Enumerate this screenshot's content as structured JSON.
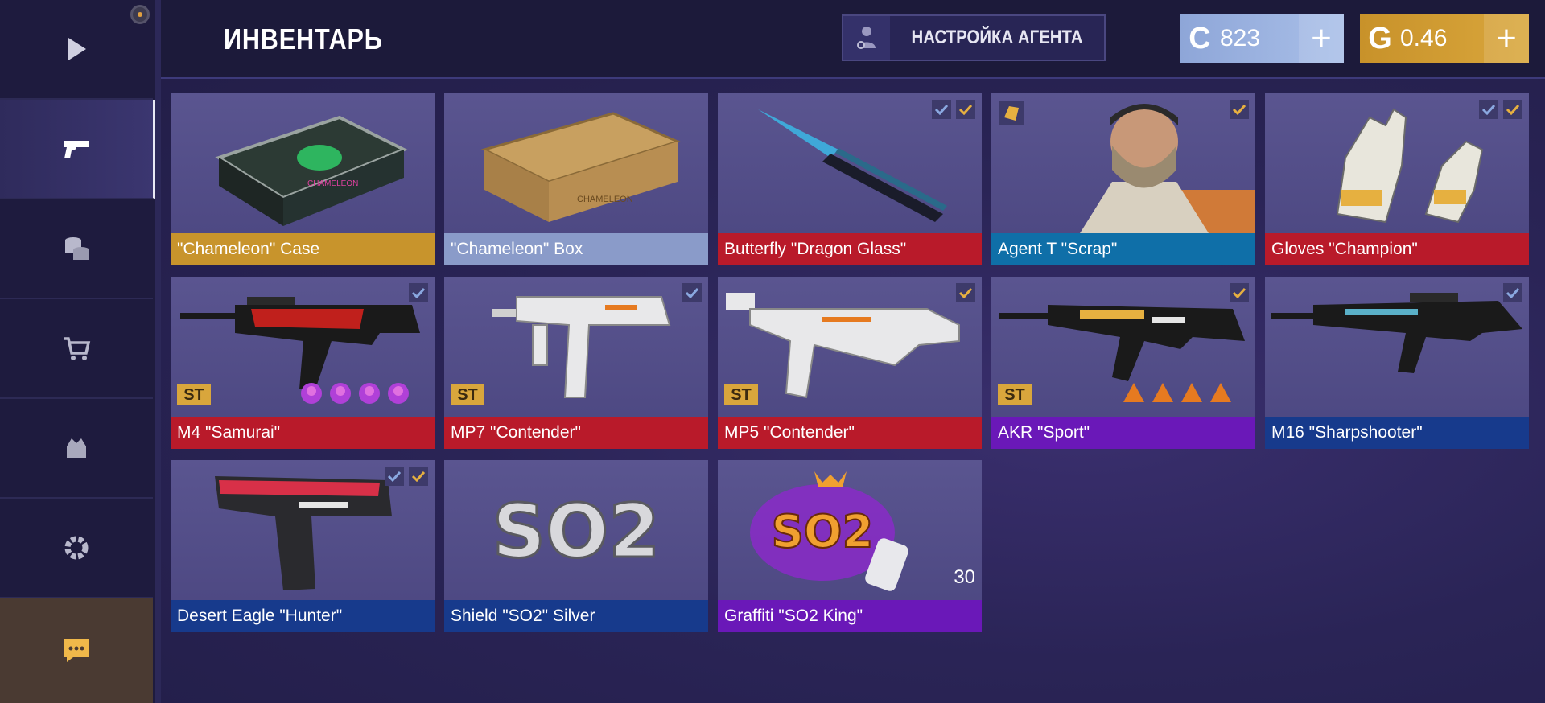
{
  "header": {
    "title": "ИНВЕНТАРЬ",
    "agent_button": "НАСТРОЙКА АГЕНТА",
    "credits": {
      "symbol": "C",
      "amount": "823",
      "plus": "+"
    },
    "gold": {
      "symbol": "G",
      "amount": "0.46",
      "plus": "+"
    }
  },
  "sidebar": {
    "items": [
      {
        "icon": "play-icon"
      },
      {
        "icon": "pistol-icon",
        "active": true
      },
      {
        "icon": "coins-icon"
      },
      {
        "icon": "cart-icon"
      },
      {
        "icon": "clan-icon"
      },
      {
        "icon": "gear-icon"
      },
      {
        "icon": "chat-icon"
      }
    ]
  },
  "colors": {
    "gold": "#d9a63c",
    "silver": "#8ea6d8",
    "red": "#c0192a",
    "blue": "#0f57a8",
    "purple": "#7a18c8",
    "dark_blue": "#173a8c"
  },
  "items": [
    {
      "name": "\"Chameleon\" Case",
      "rarity_color": "#c8942c",
      "checks": []
    },
    {
      "name": "\"Chameleon\" Box",
      "rarity_color": "#8a9bc9",
      "checks": []
    },
    {
      "name": "Butterfly \"Dragon Glass\"",
      "rarity_color": "#b91a2a",
      "checks": [
        "blue",
        "gold"
      ]
    },
    {
      "name": "Agent T \"Scrap\"",
      "rarity_color": "#0f6fa8",
      "checks": [
        "gold"
      ]
    },
    {
      "name": "Gloves \"Champion\"",
      "rarity_color": "#b91a2a",
      "checks": [
        "blue",
        "gold"
      ]
    },
    {
      "name": "M4 \"Samurai\"",
      "rarity_color": "#b91a2a",
      "checks": [
        "blue"
      ],
      "st": "ST",
      "stickers": 4
    },
    {
      "name": "MP7 \"Contender\"",
      "rarity_color": "#b91a2a",
      "checks": [
        "blue"
      ],
      "st": "ST"
    },
    {
      "name": "MP5 \"Contender\"",
      "rarity_color": "#b91a2a",
      "checks": [
        "gold"
      ],
      "st": "ST"
    },
    {
      "name": "AKR \"Sport\"",
      "rarity_color": "#6a18b8",
      "checks": [
        "gold"
      ],
      "st": "ST",
      "stickers": 4
    },
    {
      "name": "M16 \"Sharpshooter\"",
      "rarity_color": "#173a8c",
      "checks": [
        "blue"
      ]
    },
    {
      "name": "Desert Eagle \"Hunter\"",
      "rarity_color": "#173a8c",
      "checks": [
        "blue",
        "gold"
      ]
    },
    {
      "name": "Shield \"SO2\" Silver",
      "rarity_color": "#173a8c",
      "checks": []
    },
    {
      "name": "Graffiti \"SO2 King\"",
      "rarity_color": "#6a18b8",
      "checks": [],
      "qty": "30"
    }
  ],
  "art_labels": {
    "so2_shield": "SO2",
    "so2_graffiti": "SO2",
    "case_text": "CHAMELEON",
    "box_text": "CHAMELEON"
  }
}
